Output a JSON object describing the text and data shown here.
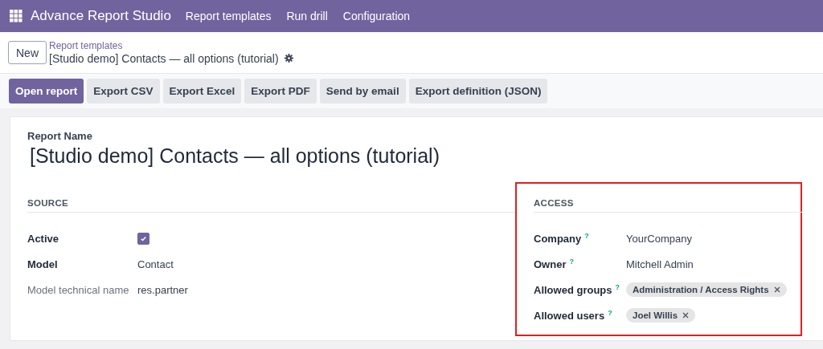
{
  "app": {
    "title": "Advance Report Studio",
    "menu": [
      "Report templates",
      "Run drill",
      "Configuration"
    ]
  },
  "control_panel": {
    "new_button": "New",
    "breadcrumb_parent": "Report templates",
    "breadcrumb_current": "[Studio demo] Contacts — all options (tutorial)"
  },
  "actions": [
    {
      "label": "Open report",
      "primary": true
    },
    {
      "label": "Export CSV",
      "primary": false
    },
    {
      "label": "Export Excel",
      "primary": false
    },
    {
      "label": "Export PDF",
      "primary": false
    },
    {
      "label": "Send by email",
      "primary": false
    },
    {
      "label": "Export definition (JSON)",
      "primary": false
    }
  ],
  "form": {
    "name_label": "Report Name",
    "name": "[Studio demo] Contacts — all options (tutorial)",
    "source": {
      "title": "SOURCE",
      "fields": [
        {
          "label": "Active",
          "kind": "checkbox",
          "checked": true
        },
        {
          "label": "Model",
          "kind": "text",
          "value": "Contact"
        },
        {
          "label": "Model technical name",
          "kind": "readonly",
          "value": "res.partner"
        }
      ]
    },
    "access": {
      "title": "ACCESS",
      "highlighted": true,
      "fields": [
        {
          "label": "Company",
          "help": "?",
          "kind": "text",
          "value": "YourCompany"
        },
        {
          "label": "Owner",
          "help": "?",
          "kind": "text",
          "value": "Mitchell Admin"
        },
        {
          "label": "Allowed groups",
          "help": "?",
          "kind": "tags",
          "tags": [
            "Administration / Access Rights"
          ]
        },
        {
          "label": "Allowed users",
          "help": "?",
          "kind": "tags",
          "tags": [
            "Joel Willis"
          ]
        }
      ]
    }
  }
}
